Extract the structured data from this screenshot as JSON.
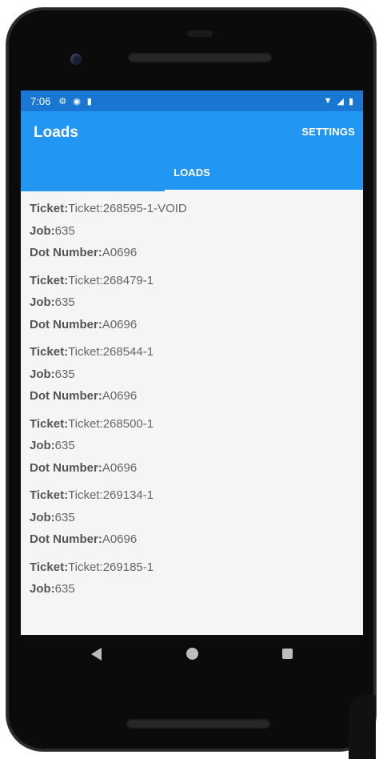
{
  "status_bar": {
    "time": "7:06",
    "left_icons": [
      "settings-icon",
      "shield-icon",
      "sd-card-icon"
    ],
    "right_icons": [
      "wifi-icon",
      "signal-icon",
      "battery-icon"
    ]
  },
  "app_bar": {
    "title": "Loads",
    "settings_label": "SETTINGS",
    "tab_label": "LOADS",
    "color": "#2196f3",
    "status_color": "#1976d2"
  },
  "field_labels": {
    "ticket": "Ticket:",
    "job": "Job:",
    "dot": "Dot Number:"
  },
  "loads": [
    {
      "ticket": "Ticket:268595-1-VOID",
      "job": "635",
      "dot": "A0696"
    },
    {
      "ticket": "Ticket:268479-1",
      "job": "635",
      "dot": "A0696"
    },
    {
      "ticket": "Ticket:268544-1",
      "job": "635",
      "dot": "A0696"
    },
    {
      "ticket": "Ticket:268500-1",
      "job": "635",
      "dot": "A0696"
    },
    {
      "ticket": "Ticket:269134-1",
      "job": "635",
      "dot": "A0696"
    },
    {
      "ticket": "Ticket:269185-1",
      "job": "635"
    }
  ],
  "nav_bar": [
    "back-icon",
    "home-icon",
    "recents-icon"
  ]
}
